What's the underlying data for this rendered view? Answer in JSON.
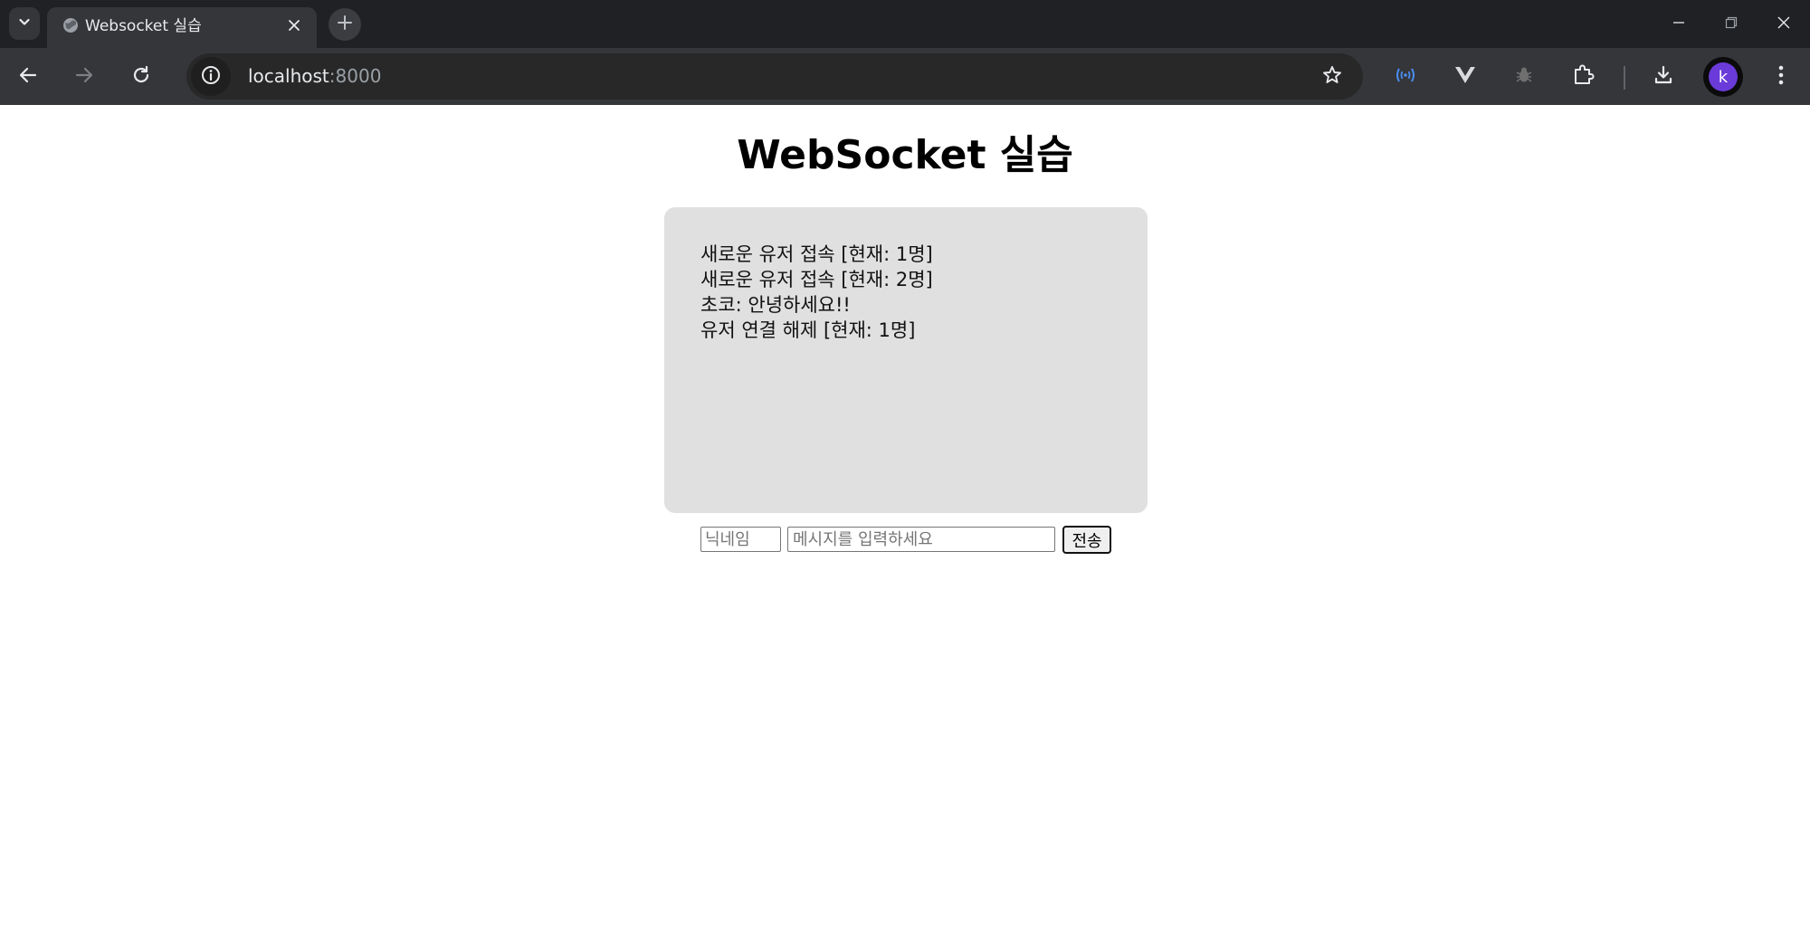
{
  "browser": {
    "tab": {
      "title": "Websocket 실습"
    },
    "address_bar": {
      "host": "localhost",
      "port": ":8000"
    },
    "profile_initial": "k",
    "icons": {
      "tab_search": "chevron-down-icon",
      "favicon": "globe-icon",
      "tab_close": "close-icon",
      "new_tab": "plus-icon",
      "minimize": "minimize-icon",
      "restore": "restore-icon",
      "close_window": "close-icon",
      "back": "arrow-left-icon",
      "forward": "arrow-right-icon",
      "reload": "reload-icon",
      "site_info": "info-icon",
      "bookmark": "star-icon",
      "extensions": [
        "radio-waves-icon",
        "vue-devtools-icon",
        "bug-icon",
        "puzzle-icon"
      ],
      "downloads": "download-icon",
      "menu": "kebab-menu-icon"
    },
    "colors": {
      "tabstrip": "#202124",
      "toolbar": "#35363a",
      "omnibox": "#282828",
      "avatar": "#6a3bd9"
    }
  },
  "page": {
    "title": "WebSocket 실습",
    "messages": [
      "새로운 유저 접속 [현재: 1명]",
      "새로운 유저 접속 [현재: 2명]",
      "초코: 안녕하세요!!",
      "유저 연결 해제 [현재: 1명]"
    ],
    "nickname_input": {
      "value": "",
      "placeholder": "닉네임"
    },
    "message_input": {
      "value": "",
      "placeholder": "메시지를 입력하세요"
    },
    "send_button_label": "전송",
    "colors": {
      "chat_box_bg": "#e0e0e0"
    }
  }
}
